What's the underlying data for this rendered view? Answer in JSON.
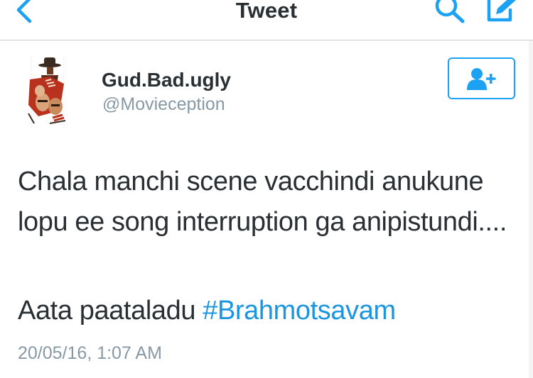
{
  "nav": {
    "title": "Tweet",
    "back_icon": "chevron-left-icon",
    "search_icon": "search-icon",
    "compose_icon": "compose-icon",
    "accent_color": "#1da1f2"
  },
  "author": {
    "name": "Gud.Bad.ugly",
    "handle": "@Movieception",
    "avatar_icon": "avatar-image",
    "follow_icon": "add-user-icon"
  },
  "tweet": {
    "body": "Chala manchi scene vacchindi anukune lopu ee song interruption ga anipistundi....",
    "line2_prefix": "Aata paataladu ",
    "hashtag": "#Brahmotsavam",
    "timestamp": "20/05/16, 1:07 AM",
    "hashtag_color": "#1b95e0"
  }
}
